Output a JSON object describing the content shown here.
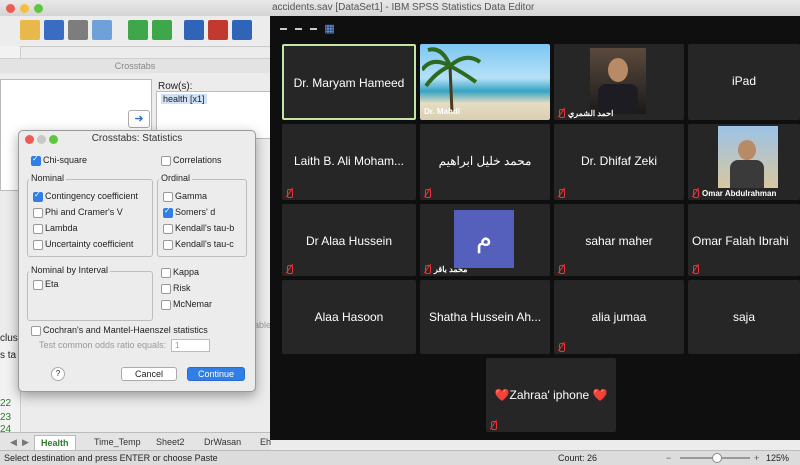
{
  "spss": {
    "title": "accidents.sav [DataSet1] - IBM SPSS Statistics Data Editor",
    "crosstabs_title": "Crosstabs",
    "rows_label": "Row(s):",
    "rows_item": "health [x1]",
    "fragment_1": "clus",
    "fragment_2": "s ta",
    "lable_fragment": "able",
    "row_numbers": [
      "22",
      "23",
      "24"
    ],
    "tabs": [
      "Health",
      "Time_Temp",
      "Sheet2",
      "DrWasan",
      "Eh"
    ],
    "status_message": "Select destination and press ENTER or choose Paste",
    "count": "Count: 26",
    "zoom": "125%"
  },
  "statistics_dialog": {
    "title": "Crosstabs: Statistics",
    "chi_square": "Chi-square",
    "correlations": "Correlations",
    "nominal_title": "Nominal",
    "contingency": "Contingency coefficient",
    "phi": "Phi and Cramer's V",
    "lambda": "Lambda",
    "uncertainty": "Uncertainty coefficient",
    "ordinal_title": "Ordinal",
    "gamma": "Gamma",
    "somers": "Somers' d",
    "tau_b": "Kendall's tau-b",
    "tau_c": "Kendall's tau-c",
    "nom_int_title": "Nominal by Interval",
    "eta": "Eta",
    "kappa": "Kappa",
    "risk": "Risk",
    "mcnemar": "McNemar",
    "cochran": "Cochran's and Mantel-Haenszel statistics",
    "odds_label": "Test common odds ratio equals:",
    "odds_value": "1",
    "help": "?",
    "cancel": "Cancel",
    "continue": "Continue",
    "checked": {
      "chi_square": true,
      "contingency": true,
      "somers": true
    }
  },
  "zoom_meeting": {
    "tiles": [
      {
        "name": "Dr. Maryam Hameed"
      },
      {
        "name": "Dr. Mahdi",
        "caption": "Dr. Mahdi"
      },
      {
        "name": "احمد الشمري",
        "caption": "احمد الشمري"
      },
      {
        "name": "iPad"
      },
      {
        "name": "Laith B. Ali Moham..."
      },
      {
        "name": "محمد خليل ابراهيم"
      },
      {
        "name": "Dr. Dhifaf Zeki"
      },
      {
        "name": "Omar Abdulrahman",
        "caption": "Omar Abdulrahman"
      },
      {
        "name": "Dr Alaa Hussein"
      },
      {
        "name": "م",
        "caption": "محمد باقر"
      },
      {
        "name": "sahar maher"
      },
      {
        "name": "Omar Falah Ibrahi"
      },
      {
        "name": "Alaa Hasoon"
      },
      {
        "name": "Shatha Hussein Ah..."
      },
      {
        "name": "alia jumaa"
      },
      {
        "name": "saja"
      },
      {
        "name": "❤️Zahraa' iphone ❤️"
      }
    ]
  }
}
